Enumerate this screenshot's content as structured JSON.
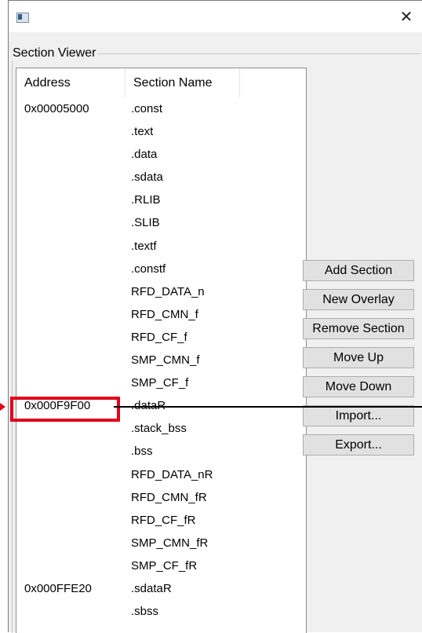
{
  "window": {
    "title": "",
    "close_glyph": "✕"
  },
  "section_viewer": {
    "legend": "Section Viewer",
    "columns": {
      "address": "Address",
      "section_name": "Section Name"
    },
    "rows": [
      {
        "address": "0x00005000",
        "name": ".const"
      },
      {
        "address": "",
        "name": ".text"
      },
      {
        "address": "",
        "name": ".data"
      },
      {
        "address": "",
        "name": ".sdata"
      },
      {
        "address": "",
        "name": ".RLIB"
      },
      {
        "address": "",
        "name": ".SLIB"
      },
      {
        "address": "",
        "name": ".textf"
      },
      {
        "address": "",
        "name": ".constf"
      },
      {
        "address": "",
        "name": "RFD_DATA_n"
      },
      {
        "address": "",
        "name": "RFD_CMN_f"
      },
      {
        "address": "",
        "name": "RFD_CF_f"
      },
      {
        "address": "",
        "name": "SMP_CMN_f"
      },
      {
        "address": "",
        "name": "SMP_CF_f"
      },
      {
        "address": "0x000F9F00",
        "name": ".dataR"
      },
      {
        "address": "",
        "name": ".stack_bss"
      },
      {
        "address": "",
        "name": ".bss"
      },
      {
        "address": "",
        "name": "RFD_DATA_nR"
      },
      {
        "address": "",
        "name": "RFD_CMN_fR"
      },
      {
        "address": "",
        "name": "RFD_CF_fR"
      },
      {
        "address": "",
        "name": "SMP_CMN_fR"
      },
      {
        "address": "",
        "name": "SMP_CF_fR"
      },
      {
        "address": "0x000FFE20",
        "name": ".sdataR"
      },
      {
        "address": "",
        "name": ".sbss"
      }
    ]
  },
  "buttons": {
    "add_section": "Add Section",
    "new_overlay": "New Overlay",
    "remove_section": "Remove Section",
    "move_up": "Move Up",
    "move_down": "Move Down",
    "import": "Import...",
    "export": "Export..."
  },
  "colors": {
    "highlight": "#e3001b",
    "window_bg": "#f0f0f0",
    "button_bg": "#e1e1e1"
  },
  "icons": {
    "app": "app-window-icon",
    "close": "close-icon"
  }
}
